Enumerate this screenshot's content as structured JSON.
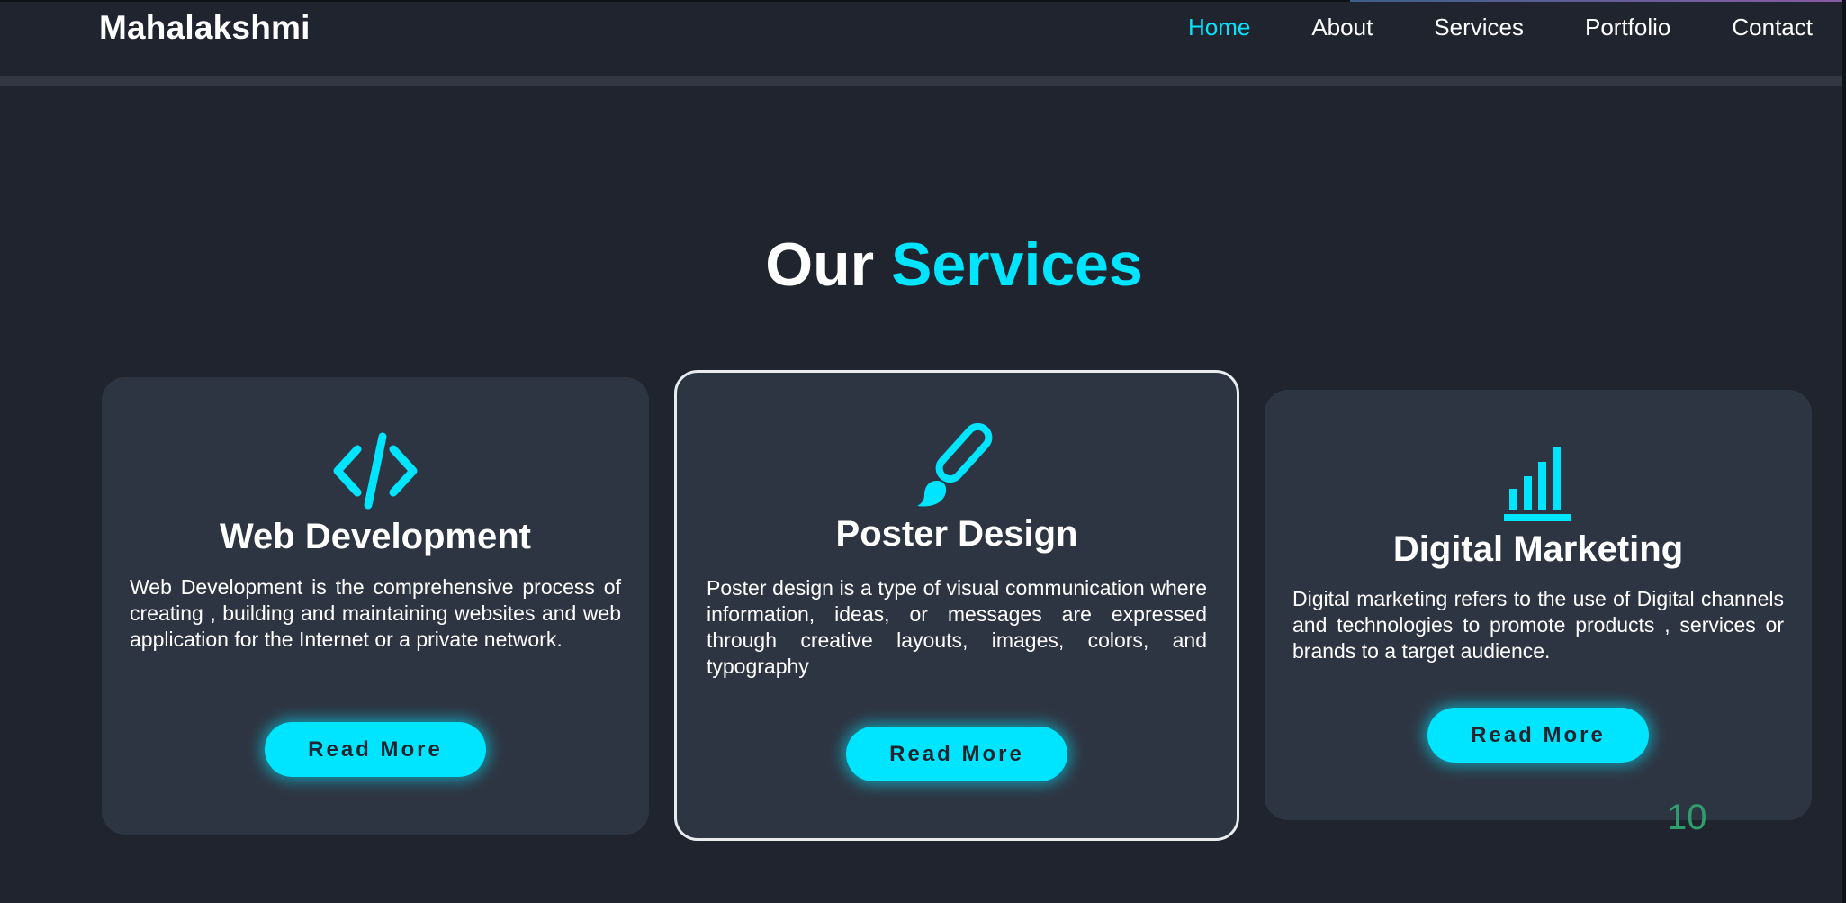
{
  "header": {
    "logo": "Mahalakshmi",
    "nav": [
      {
        "label": "Home",
        "active": true
      },
      {
        "label": "About",
        "active": false
      },
      {
        "label": "Services",
        "active": false
      },
      {
        "label": "Portfolio",
        "active": false
      },
      {
        "label": "Contact",
        "active": false
      }
    ]
  },
  "section": {
    "title_part1": "Our",
    "title_part2": "Services"
  },
  "cards": [
    {
      "icon": "code-icon",
      "title": "Web Development",
      "description": "Web Development is the comprehensive process of creating , building and maintaining websites and web application for the Internet or a private network.",
      "button": "Read More"
    },
    {
      "icon": "paint-brush-icon",
      "title": "Poster Design",
      "description": "Poster design is a type of visual communication where information, ideas, or messages are expressed through creative layouts, images, colors, and typography",
      "button": "Read More"
    },
    {
      "icon": "bar-chart-icon",
      "title": "Digital Marketing",
      "description": "Digital marketing refers to the use of Digital channels and technologies to promote products , services or brands to a target audience.",
      "button": "Read More"
    }
  ],
  "page_number": "10",
  "colors": {
    "background": "#1f242e",
    "card": "#2e3542",
    "accent": "#00e5ff",
    "text": "#ffffff",
    "page_number": "#2e9e6b"
  }
}
